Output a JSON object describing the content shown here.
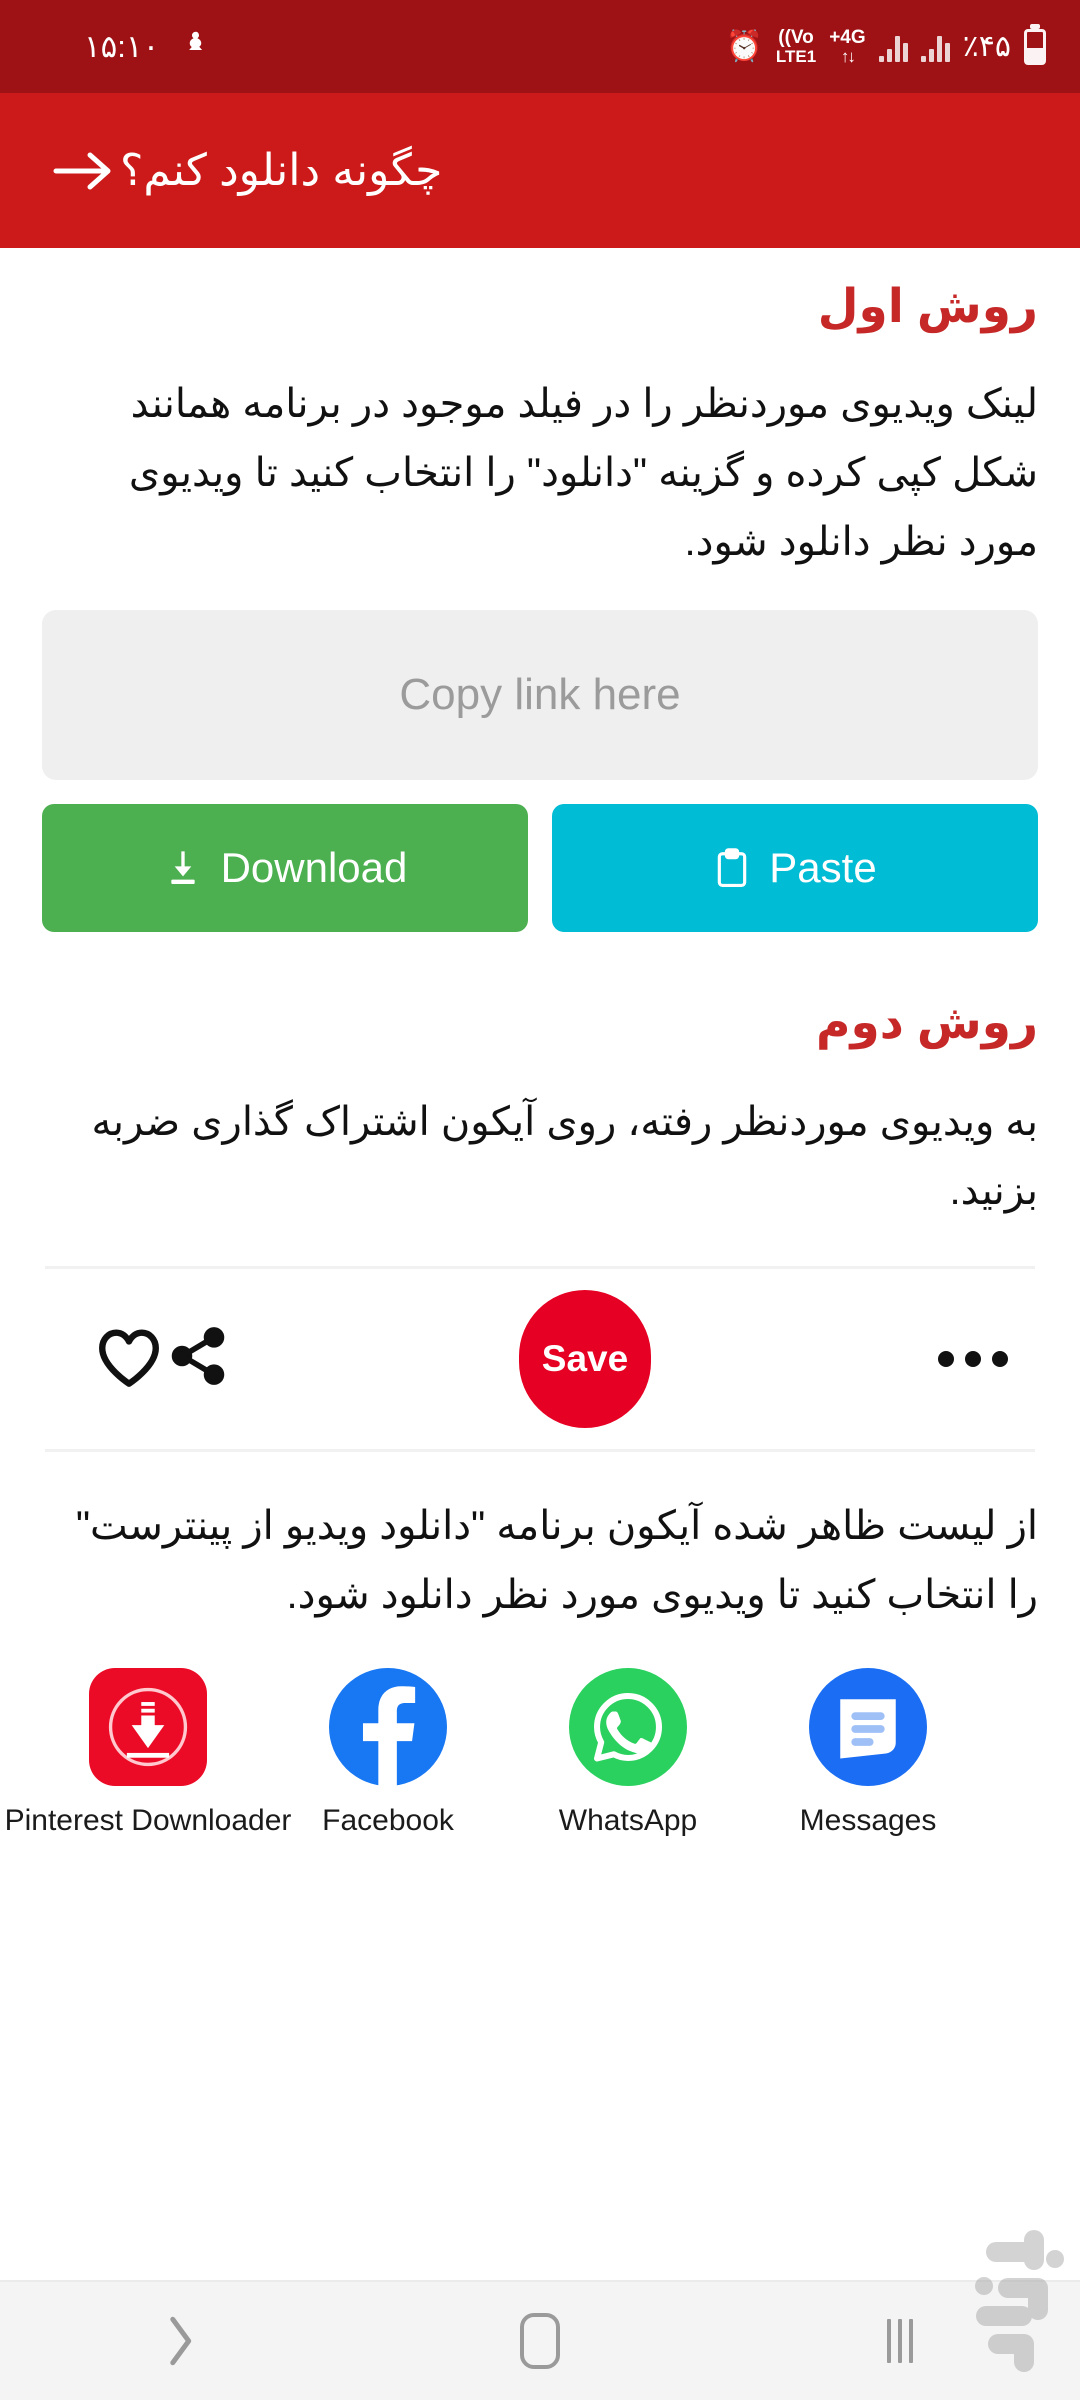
{
  "statusbar": {
    "battery_percent": "٪۴۵",
    "network_tech_line1": "4G+",
    "network_tech_line2": "↓↑",
    "volte_line1": "Vo))",
    "volte_line2": "LTE1",
    "alarm_icon": "alarm-clock-icon",
    "vibrate_icon": "vibrate-icon",
    "time": "۱۵:۱۰"
  },
  "appbar": {
    "back_icon": "arrow-right-icon",
    "title": "چگونه دانلود کنم؟"
  },
  "method_one": {
    "title": "روش اول",
    "body": "لینک ویدیوی موردنظر را در فیلد موجود در برنامه همانند شکل کپی کرده و گزینه \"دانلود\" را انتخاب کنید تا ویدیوی مورد نظر دانلود شود.",
    "link_field_placeholder": "Copy link here",
    "paste_label": "Paste",
    "paste_icon": "clipboard-icon",
    "download_label": "Download",
    "download_icon": "download-arrow-icon"
  },
  "method_two": {
    "title": "روش دوم",
    "body": "به ویدیوی موردنظر رفته، روی آیکون اشتراک گذاری ضربه بزنید.",
    "body2": "از لیست ظاهر شده آیکون برنامه \"دانلود ویدیو از پینترست\" را انتخاب کنید تا ویدیوی مورد نظر دانلود شود."
  },
  "pinterest_strip": {
    "heart_icon": "heart-outline-icon",
    "share_icon": "share-node-icon",
    "save_label": "Save",
    "more_icon": "more-horizontal-icon"
  },
  "share_apps": [
    {
      "label": "Pinterest Downloader",
      "icon": "pinterest-downloader-icon"
    },
    {
      "label": "Facebook",
      "icon": "facebook-icon"
    },
    {
      "label": "WhatsApp",
      "icon": "whatsapp-icon"
    },
    {
      "label": "Messages",
      "icon": "messages-icon"
    }
  ],
  "navbar": {
    "recents_icon": "recents-icon",
    "home_icon": "home-icon",
    "back_icon": "nav-back-icon",
    "watermark_icon": "bazaar-watermark-icon"
  },
  "colors": {
    "statusbar_bg": "#9e1114",
    "appbar_bg": "#cc1a1a",
    "heading_red": "#c62828",
    "paste_cyan": "#00bcd4",
    "download_green": "#4caf50",
    "save_red": "#e60023",
    "field_gray": "#efefef",
    "navbar_bg": "#f4f4f4"
  }
}
